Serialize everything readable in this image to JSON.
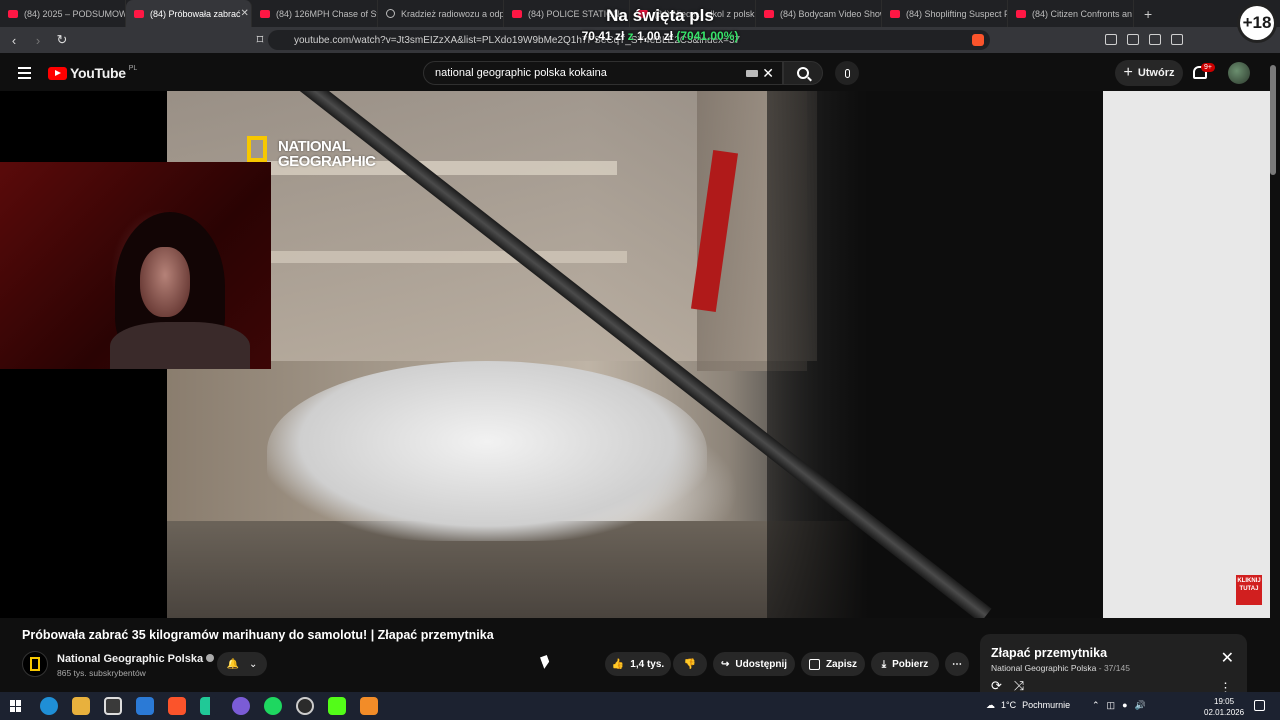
{
  "browser": {
    "tabs": [
      {
        "label": "(84) 2025 – PODSUMOWA",
        "icon": "youtube-icon"
      },
      {
        "label": "(84) Próbowała zabrać",
        "icon": "youtube-icon",
        "active": true
      },
      {
        "label": "(84) 126MPH Chase of Sto",
        "icon": "youtube-icon"
      },
      {
        "label": "Kradzież radiowozu a odp",
        "icon": "globe-icon"
      },
      {
        "label": "(84) POLICE STATION",
        "icon": "youtube-icon"
      },
      {
        "label": "(84) Nieco... alkol z polsk",
        "icon": "youtube-icon"
      },
      {
        "label": "(84) Bodycam Video Show",
        "icon": "youtube-icon"
      },
      {
        "label": "(84) Shoplifting Suspect P",
        "icon": "youtube-icon"
      },
      {
        "label": "(84) Citizen Confronts an",
        "icon": "youtube-icon"
      }
    ],
    "url": "youtube.com/watch?v=Jt3smEIZzXA&list=PLXdo19W9bMe2Q1h7PSeCqT_SY4eBLE2C3&index=37"
  },
  "overlay": {
    "donation_title": "Na święta pls",
    "donation_amount": "70,41 zł",
    "donation_from": "z",
    "donation_base": "1,00 zł",
    "donation_percent": "(7041.00%)",
    "age_badge": "+18"
  },
  "youtube": {
    "logo_text": "YouTube",
    "country": "PL",
    "search_value": "national geographic polska kokaina",
    "create_label": "Utwórz",
    "notif_count": "9+"
  },
  "video": {
    "watermark": "NATIONAL GEOGRAPHIC",
    "sub_badge": "KLIKNIJ TUTAJ",
    "title": "Próbowała zabrać 35 kilogramów marihuany do samolotu! | Złapać przemytnika",
    "channel": "National Geographic Polska",
    "subscribers": "865 tys. subskrybentów",
    "likes": "1,4 tys.",
    "share": "Udostępnij",
    "save": "Zapisz",
    "download": "Pobierz"
  },
  "playlist": {
    "title": "Złapać przemytnika",
    "channel": "National Geographic Polska",
    "position": "37/145"
  },
  "taskbar": {
    "weather_temp": "1°C",
    "weather_desc": "Pochmurnie",
    "time": "19:05",
    "date": "02.01.2026"
  },
  "colors": {
    "accent_red": "#ff0000",
    "natgeo_yellow": "#f7c800",
    "donation_green": "#37e36a"
  }
}
